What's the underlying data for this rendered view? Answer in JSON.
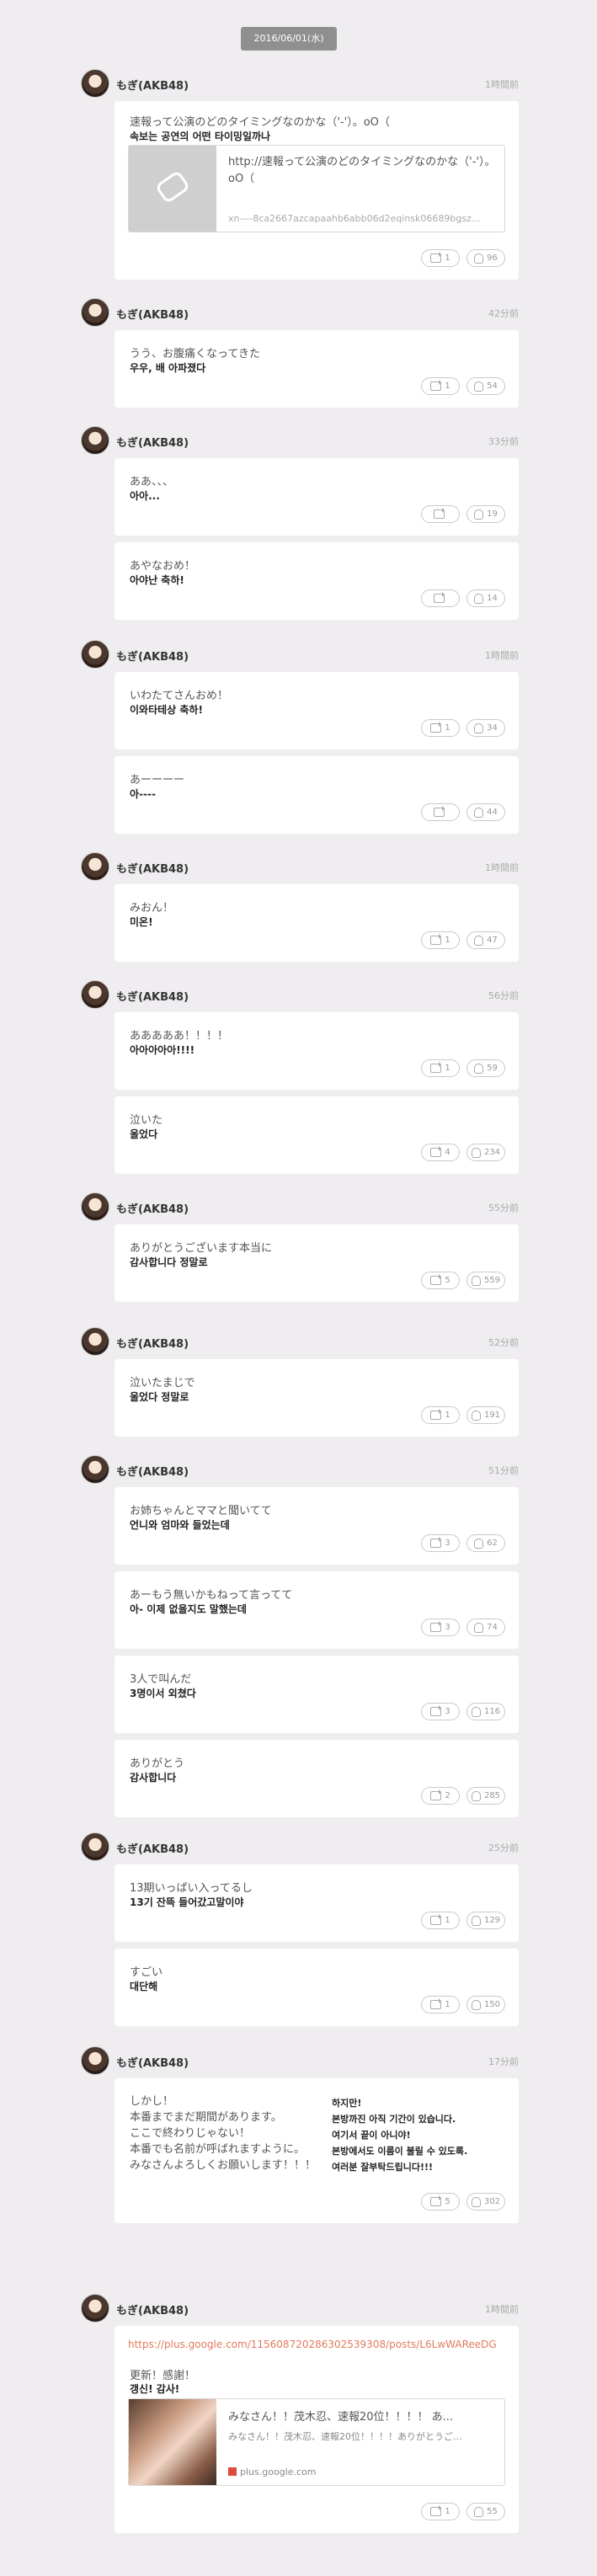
{
  "date_label": "2016/06/01(水)",
  "groups": [
    {
      "name": "もぎ(AKB48)",
      "time": "1時間前",
      "cards": [
        {
          "ja": "速報って公演のどのタイミングなのかな（'-'）。oO（",
          "ko": "속보는 공연의 어떤 타이밍일까나",
          "rt": "1",
          "like": "96",
          "link": {
            "title": "http://速報って公演のどのタイミングなのかな（'-'）。oO（",
            "url": "xn----8ca2667azcapaahb6abb06d2eqinsk06689bgsz..."
          }
        }
      ]
    },
    {
      "name": "もぎ(AKB48)",
      "time": "42分前",
      "cards": [
        {
          "ja": "うう、お腹痛くなってきた",
          "ko": "우우, 배 아파졌다",
          "rt": "1",
          "like": "54"
        }
      ]
    },
    {
      "name": "もぎ(AKB48)",
      "time": "33分前",
      "cards": [
        {
          "ja": "ああ、、、",
          "ko": "아아...",
          "rt": "",
          "like": "19"
        },
        {
          "ja": "あやなおめ！",
          "ko": "아야난 축하!",
          "rt": "",
          "like": "14"
        }
      ]
    },
    {
      "name": "もぎ(AKB48)",
      "time": "1時間前",
      "cards": [
        {
          "ja": "いわたてさんおめ！",
          "ko": "이와타테상 축하!",
          "rt": "1",
          "like": "34"
        },
        {
          "ja": "あーーーー",
          "ko": "아----",
          "rt": "",
          "like": "44"
        }
      ]
    },
    {
      "name": "もぎ(AKB48)",
      "time": "1時間前",
      "cards": [
        {
          "ja": "みおん！",
          "ko": "미온!",
          "rt": "1",
          "like": "47"
        }
      ]
    },
    {
      "name": "もぎ(AKB48)",
      "time": "56分前",
      "cards": [
        {
          "ja": "あああああ！！！！",
          "ko": "아아아아아!!!!",
          "rt": "1",
          "like": "59"
        },
        {
          "ja": "泣いた",
          "ko": "울었다",
          "rt": "4",
          "like": "234"
        }
      ]
    },
    {
      "name": "もぎ(AKB48)",
      "time": "55分前",
      "cards": [
        {
          "ja": "ありがとうございます本当に",
          "ko": "감사합니다 정말로",
          "rt": "5",
          "like": "559"
        }
      ]
    },
    {
      "name": "もぎ(AKB48)",
      "time": "52分前",
      "cards": [
        {
          "ja": "泣いたまじで",
          "ko": "울었다 정말로",
          "rt": "1",
          "like": "191"
        }
      ]
    },
    {
      "name": "もぎ(AKB48)",
      "time": "51分前",
      "cards": [
        {
          "ja": "お姉ちゃんとママと聞いてて",
          "ko": "언니와 엄마와 들었는데",
          "rt": "3",
          "like": "62"
        },
        {
          "ja": "あーもう無いかもねって言ってて",
          "ko": "아- 이제 없을지도 말했는데",
          "rt": "3",
          "like": "74"
        },
        {
          "ja": "3人で叫んだ",
          "ko": "3명이서 외쳤다",
          "rt": "3",
          "like": "116"
        },
        {
          "ja": "ありがとう",
          "ko": "감사합니다",
          "rt": "2",
          "like": "285"
        }
      ]
    },
    {
      "name": "もぎ(AKB48)",
      "time": "25分前",
      "cards": [
        {
          "ja": "13期いっぱい入ってるし",
          "ko": "13기 잔뜩 들어갔고말이야",
          "rt": "1",
          "like": "129"
        },
        {
          "ja": "すごい",
          "ko": "대단해",
          "rt": "1",
          "like": "150"
        }
      ]
    },
    {
      "name": "もぎ(AKB48)",
      "time": "17分前",
      "cards": [
        {
          "ja_lines": [
            "しかし！",
            "本番までまだ期間があります。",
            "ここで終わりじゃない！",
            "本番でも名前が呼ばれますように。",
            "みなさんよろしくお願いします！！！"
          ],
          "ko_lines": [
            "하지만!",
            "본방까진 아직 기간이 있습니다.",
            "여기서 끝이 아니야!",
            "본방에서도 이름이 불릴 수 있도록.",
            "여러분 잘부탁드립니다!!!"
          ],
          "rt": "5",
          "like": "302"
        }
      ]
    },
    {
      "name": "もぎ(AKB48)",
      "time": "1時間前",
      "cards": [
        {
          "url": "https://plus.google.com/115608720286302539308/posts/L6LwWAReeDG",
          "ja": "更新！感謝！",
          "ko": "갱신! 감사!",
          "gcard": {
            "title": "みなさん！！茂木忍、速報20位！！！！ あ...",
            "desc": "みなさん！！茂木忍、速報20位！！！！ありがとうご...",
            "domain": "plus.google.com"
          },
          "rt": "1",
          "like": "55"
        }
      ]
    }
  ]
}
